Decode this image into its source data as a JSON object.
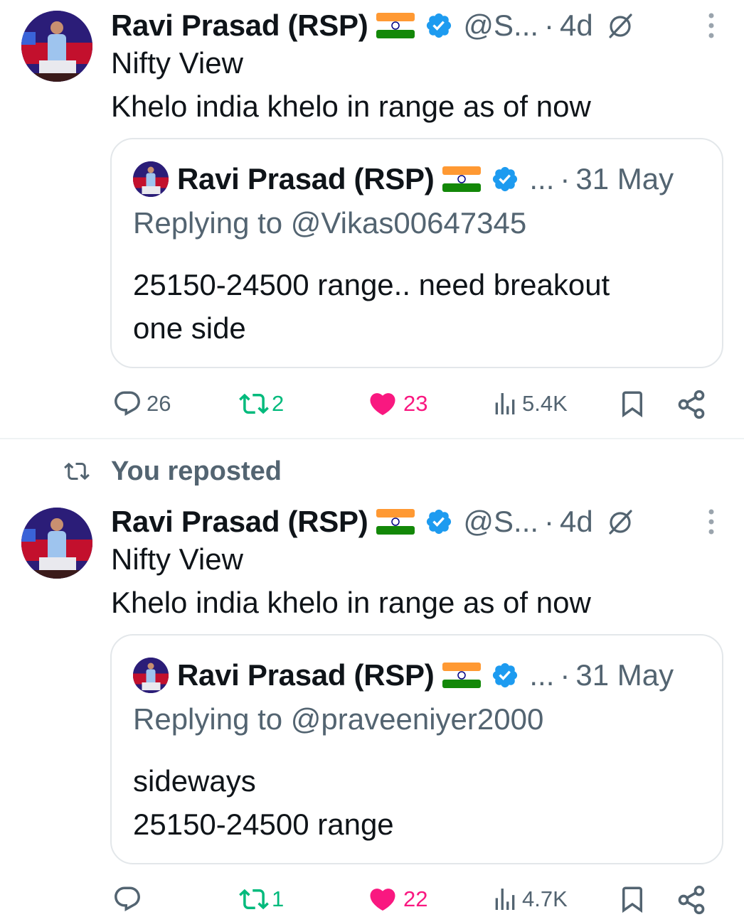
{
  "posts": [
    {
      "author": "Ravi Prasad (RSP)",
      "handle": "@S...",
      "dot": "·",
      "time": "4d",
      "line1": "Nifty View",
      "line2": "Khelo india khelo in range as of now",
      "quote": {
        "author": "Ravi Prasad (RSP)",
        "ellipsis": "...",
        "dot": "·",
        "time": "31 May",
        "replying": "Replying to @Vikas00647345",
        "body1": "25150-24500 range.. need breakout",
        "body2": "one side"
      },
      "stats": {
        "replies": "26",
        "reposts": "2",
        "likes": "23",
        "views": "5.4K"
      }
    },
    {
      "author": "Ravi Prasad (RSP)",
      "handle": "@S...",
      "dot": "·",
      "time": "4d",
      "line1": "Nifty View",
      "line2": "Khelo india khelo in range as of now",
      "quote": {
        "author": "Ravi Prasad (RSP)",
        "ellipsis": "...",
        "dot": "·",
        "time": "31 May",
        "replying": "Replying to @praveeniyer2000",
        "body1": "sideways",
        "body2": "25150-24500 range"
      },
      "stats": {
        "replies": "",
        "reposts": "1",
        "likes": "22",
        "views": "4.7K"
      }
    }
  ],
  "repost_label": "You reposted",
  "colors": {
    "text": "#0f1419",
    "secondary": "#536471",
    "verified": "#1d9bf0",
    "like": "#f91880",
    "repost": "#00ba7c",
    "border": "#e3e7ea"
  },
  "icons": [
    "verified-icon",
    "flag-icon",
    "grok-icon",
    "more-icon",
    "reply-icon",
    "repost-icon",
    "like-icon",
    "views-icon",
    "bookmark-icon",
    "share-icon"
  ]
}
